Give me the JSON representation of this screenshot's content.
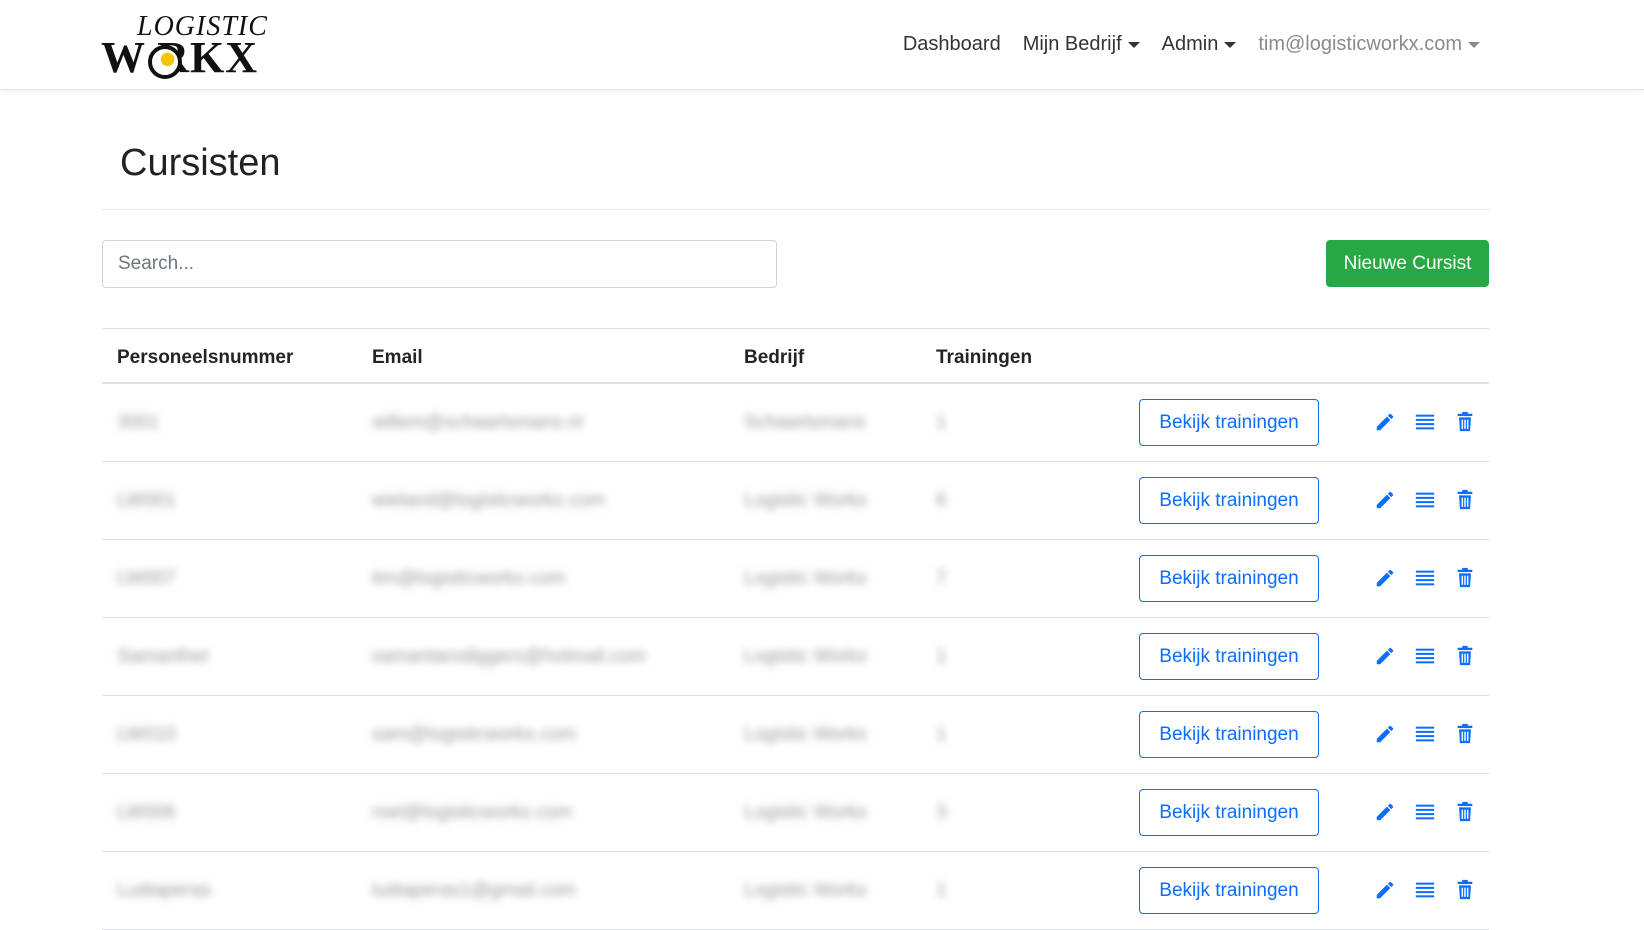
{
  "navbar": {
    "logo_top": "LOGISTIC",
    "logo_bottom": "W  RKX",
    "links": [
      "Dashboard",
      "Mijn Bedrijf",
      "Admin"
    ],
    "user": "tim@logisticworkx.com"
  },
  "page": {
    "title": "Cursisten",
    "search_placeholder": "Search...",
    "new_button": "Nieuwe Cursist"
  },
  "table": {
    "headers": [
      "Personeelsnummer",
      "Email",
      "Bedrijf",
      "Trainingen"
    ],
    "view_label": "Bekijk trainingen",
    "rows": [
      {
        "nr": "3001",
        "email": "willem@schaartsmans.nl",
        "company": "Schaartsmans",
        "trainingen": "1"
      },
      {
        "nr": "LW001",
        "email": "wieland@logisticworkx.com",
        "company": "Logistic Workx",
        "trainingen": "6"
      },
      {
        "nr": "LW007",
        "email": "tim@logisticworkx.com",
        "company": "Logistic Workx",
        "trainingen": "7"
      },
      {
        "nr": "Samanther",
        "email": "samantarodiggers@hotmail.com",
        "company": "Logistic Workx",
        "trainingen": "1"
      },
      {
        "nr": "LW010",
        "email": "sam@logisticworkx.com",
        "company": "Logistic Workx",
        "trainingen": "1"
      },
      {
        "nr": "LW006",
        "email": "roel@logisticworkx.com",
        "company": "Logistic Workx",
        "trainingen": "3"
      },
      {
        "nr": "Ludiaperas",
        "email": "ludiaperas1@gmail.com",
        "company": "Logistic Workx",
        "trainingen": "1"
      }
    ]
  },
  "colors": {
    "primary": "#0d6efd",
    "success": "#28a745"
  },
  "icons": [
    "pencil-icon",
    "list-icon",
    "trash-icon"
  ]
}
